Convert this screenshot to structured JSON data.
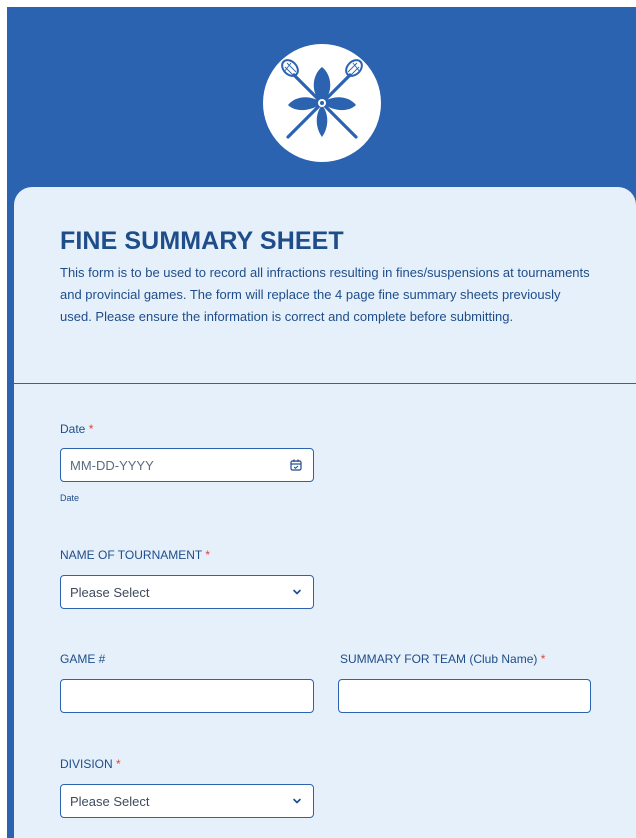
{
  "form": {
    "title": "FINE SUMMARY SHEET",
    "description": "This form is to be used to record all infractions resulting in fines/suspensions at tournaments and provincial games. The form will replace the 4 page fine summary sheets previously used. Please ensure the information is correct and complete before submitting."
  },
  "fields": {
    "date": {
      "label": "Date",
      "required_mark": "*",
      "placeholder": "MM-DD-YYYY",
      "sublabel": "Date"
    },
    "tournament": {
      "label": "NAME OF TOURNAMENT",
      "required_mark": "*",
      "selected": "Please Select"
    },
    "game_number": {
      "label": "GAME #",
      "value": ""
    },
    "summary_team": {
      "label": "SUMMARY FOR TEAM (Club Name)",
      "required_mark": "*",
      "value": ""
    },
    "division": {
      "label": "DIVISION",
      "required_mark": "*",
      "selected": "Please Select"
    }
  },
  "icons": {
    "logo": "lacrosse-trillium-logo",
    "date_picker": "calendar-icon",
    "dropdown": "chevron-down-icon"
  },
  "colors": {
    "brand_blue": "#2b63b0",
    "title_blue": "#1f4d8a",
    "card_background": "#e5f0fa",
    "required_red": "#e0443a"
  }
}
